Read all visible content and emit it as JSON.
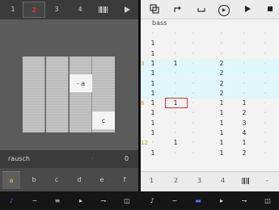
{
  "left_tabs": {
    "items": [
      "1",
      "2",
      "3",
      "4"
    ],
    "active": "2"
  },
  "grid": {
    "tile_a_label": "- a",
    "tile_c_label": "c"
  },
  "left_status": {
    "name": "rausch",
    "center": "·",
    "value": "0"
  },
  "left_keys": {
    "items": [
      "a",
      "b",
      "c",
      "d",
      "e",
      "f"
    ],
    "active": "a"
  },
  "right_toolbar": {
    "icons": [
      "copy-icon",
      "redo-icon",
      "return-icon",
      "record-icon",
      "play-icon",
      "stop-icon"
    ]
  },
  "track": {
    "name": "bass"
  },
  "sequencer": {
    "column_dot": "·",
    "rows": [
      {
        "no": "",
        "c1": "",
        "c2": "",
        "c3": "",
        "c4": ""
      },
      {
        "no": "",
        "c1": "1",
        "c2": "",
        "c3": "",
        "c4": ""
      },
      {
        "no": "",
        "c1": "1",
        "c2": "",
        "c3": "",
        "c4": ""
      },
      {
        "no": "3",
        "c1": "1",
        "c2": "1",
        "c3": "2",
        "c4": ""
      },
      {
        "no": "",
        "c1": "1",
        "c2": "",
        "c3": "2",
        "c4": ""
      },
      {
        "no": "",
        "c1": "1",
        "c2": "",
        "c3": "2",
        "c4": ""
      },
      {
        "no": "",
        "c1": "1",
        "c2": "",
        "c3": "2",
        "c4": ""
      },
      {
        "no": "6",
        "c1": "1",
        "c2": "1",
        "c3": "1",
        "c4": "1"
      },
      {
        "no": "",
        "c1": "1",
        "c2": "",
        "c3": "1",
        "c4": "2"
      },
      {
        "no": "",
        "c1": "1",
        "c2": "",
        "c3": "1",
        "c4": "3"
      },
      {
        "no": "",
        "c1": "1",
        "c2": "",
        "c3": "1",
        "c4": "4"
      },
      {
        "no": "12",
        "c1": "",
        "c2": "1",
        "c3": "1",
        "c4": "1"
      },
      {
        "no": "",
        "c1": "1",
        "c2": "",
        "c3": "1",
        "c4": "2"
      }
    ]
  },
  "right_footer": {
    "items": [
      "1",
      "2",
      "3",
      "4"
    ]
  },
  "bottom_bar": {
    "icons": [
      "note-icon",
      "wave-icon",
      "list-icon",
      "play-icon",
      "route-icon",
      "window-icon",
      "note-icon",
      "wave-icon",
      "list-icon",
      "play-icon",
      "route-icon",
      "window-icon"
    ]
  },
  "colors": {
    "highlight_row": "#dff6fb",
    "selection": "#d83030",
    "active_tab": "#e0342b",
    "accent_blue": "#4f6fd8"
  }
}
